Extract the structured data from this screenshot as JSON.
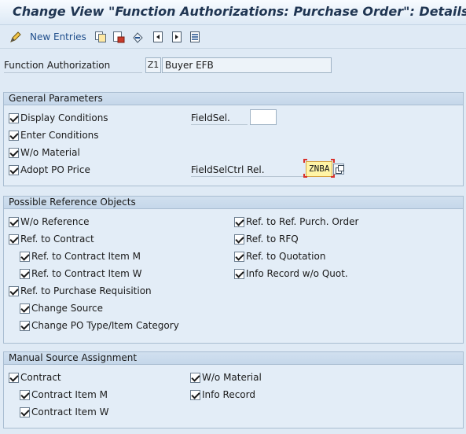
{
  "window": {
    "title": "Change View \"Function Authorizations: Purchase Order\": Details"
  },
  "toolbar": {
    "items": [
      {
        "icon": "edit-pencil-icon"
      },
      {
        "label": "New Entries"
      },
      {
        "icon": "copy-icon"
      },
      {
        "icon": "delete-icon"
      },
      {
        "icon": "undo-icon"
      },
      {
        "icon": "previous-entry-icon"
      },
      {
        "icon": "next-entry-icon"
      },
      {
        "icon": "select-all-icon"
      }
    ]
  },
  "header": {
    "label": "Function Authorization",
    "code": "Z1",
    "value": "Buyer EFB"
  },
  "general": {
    "title": "General Parameters",
    "display_conditions": {
      "label": "Display Conditions",
      "checked": true
    },
    "enter_conditions": {
      "label": "Enter Conditions",
      "checked": true
    },
    "wo_material": {
      "label": "W/o Material",
      "checked": true
    },
    "adopt_po_price": {
      "label": "Adopt PO Price",
      "checked": true
    },
    "fieldsel_label": "FieldSel.",
    "fieldsel_value": "",
    "fieldselctrl_label": "FieldSelCtrl Rel.",
    "fieldselctrl_value": "ZNBA"
  },
  "reference": {
    "title": "Possible Reference Objects",
    "wo_reference": {
      "label": "W/o Reference",
      "checked": true
    },
    "ref_contract": {
      "label": "Ref. to Contract",
      "checked": true
    },
    "ref_contract_item_m": {
      "label": "Ref. to Contract Item M",
      "checked": true
    },
    "ref_contract_item_w": {
      "label": "Ref. to Contract Item W",
      "checked": true
    },
    "ref_purch_req": {
      "label": "Ref. to Purchase Requisition",
      "checked": true
    },
    "change_source": {
      "label": "Change Source",
      "checked": true
    },
    "change_po_type": {
      "label": "Change PO Type/Item Category",
      "checked": true
    },
    "ref_ref_purch_order": {
      "label": "Ref. to Ref. Purch. Order",
      "checked": true
    },
    "ref_rfq": {
      "label": "Ref. to RFQ",
      "checked": true
    },
    "ref_quotation": {
      "label": "Ref. to Quotation",
      "checked": true
    },
    "info_record_wo_quot": {
      "label": "Info Record w/o Quot.",
      "checked": true
    }
  },
  "manual": {
    "title": "Manual Source Assignment",
    "contract": {
      "label": "Contract",
      "checked": true
    },
    "contract_item_m": {
      "label": "Contract Item M",
      "checked": true
    },
    "contract_item_w": {
      "label": "Contract Item W",
      "checked": true
    },
    "wo_material": {
      "label": "W/o Material",
      "checked": true
    },
    "info_record": {
      "label": "Info Record",
      "checked": true
    }
  }
}
